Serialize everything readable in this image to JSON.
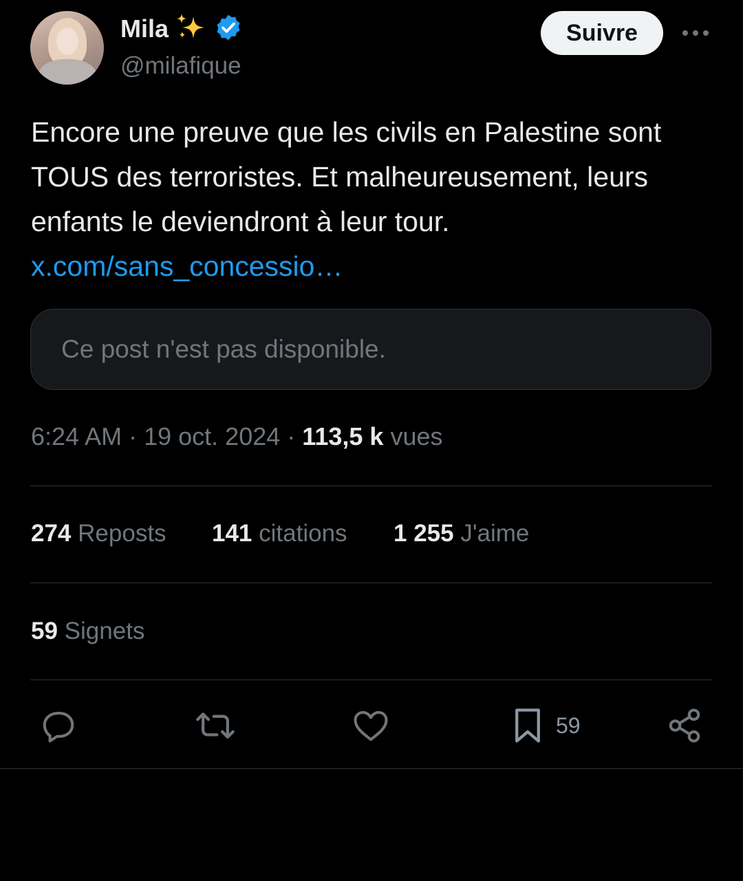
{
  "author": {
    "name": "Mila",
    "handle": "@milafique",
    "verified": true
  },
  "header": {
    "follow_label": "Suivre"
  },
  "tweet": {
    "text": "Encore une preuve que les civils en Palestine sont TOUS des terroristes. Et malheureusement, leurs enfants le deviendront à leur tour. ",
    "link": "x.com/sans_concessio…"
  },
  "quote": {
    "unavailable": "Ce post n'est pas disponible."
  },
  "meta": {
    "time": "6:24 AM",
    "date": "19 oct. 2024",
    "views": "113,5 k",
    "views_label": "vues"
  },
  "stats": {
    "reposts": {
      "count": "274",
      "label": "Reposts"
    },
    "quotes": {
      "count": "141",
      "label": "citations"
    },
    "likes": {
      "count": "1 255",
      "label": "J'aime"
    },
    "bookmarks": {
      "count": "59",
      "label": "Signets"
    }
  },
  "actions": {
    "bookmark_count": "59"
  },
  "colors": {
    "link": "#1d9bf0",
    "muted": "#71767b",
    "text": "#e7e9ea",
    "verified": "#1d9bf0",
    "sparkle": "#ffc83d"
  }
}
